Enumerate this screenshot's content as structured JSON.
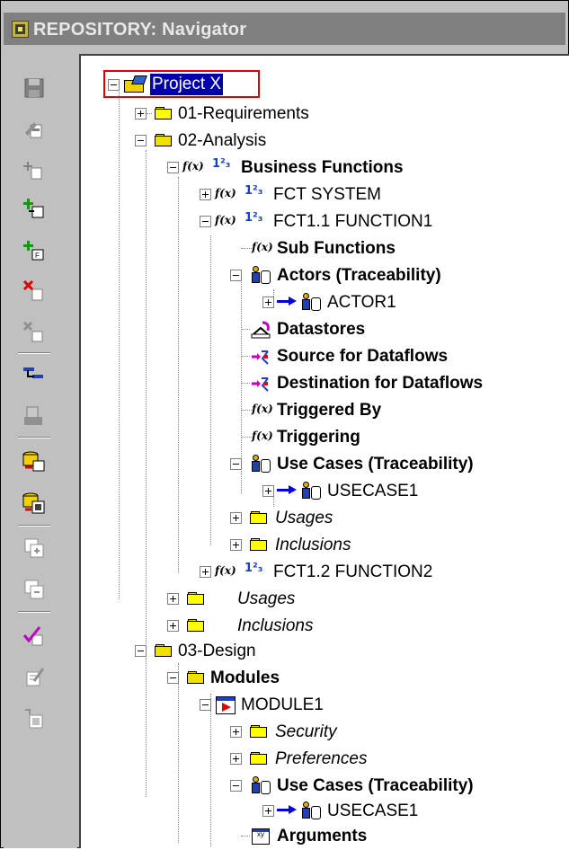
{
  "window": {
    "title": "REPOSITORY: Navigator"
  },
  "toolbar": {
    "buttons": [
      "save-icon",
      "edit-object-icon",
      "create-icon",
      "create-child-icon",
      "create-link-icon",
      "delete-icon",
      "delete-link-icon",
      "hierarchy-icon",
      "print-icon",
      "load-icon",
      "generate-icon",
      "expand-icon",
      "collapse-icon",
      "check-icon",
      "edit-check-icon",
      "disabled-icon"
    ]
  },
  "tree": {
    "nodes": [
      {
        "label": "Project X"
      },
      {
        "label": "01-Requirements"
      },
      {
        "label": "02-Analysis"
      },
      {
        "label": "Business Functions"
      },
      {
        "label": "FCT SYSTEM"
      },
      {
        "label": "FCT1.1 FUNCTION1"
      },
      {
        "label": "Sub Functions"
      },
      {
        "label": "Actors (Traceability)"
      },
      {
        "label": "ACTOR1"
      },
      {
        "label": "Datastores"
      },
      {
        "label": "Source for Dataflows"
      },
      {
        "label": "Destination for Dataflows"
      },
      {
        "label": "Triggered By"
      },
      {
        "label": "Triggering"
      },
      {
        "label": "Use Cases  (Traceability)"
      },
      {
        "label": "USECASE1"
      },
      {
        "label": "Usages"
      },
      {
        "label": "Inclusions"
      },
      {
        "label": "FCT1.2 FUNCTION2"
      },
      {
        "label": "Usages"
      },
      {
        "label": "Inclusions"
      },
      {
        "label": "03-Design"
      },
      {
        "label": "Modules"
      },
      {
        "label": "MODULE1"
      },
      {
        "label": "Security"
      },
      {
        "label": "Preferences"
      },
      {
        "label": "Use Cases  (Traceability)"
      },
      {
        "label": "USECASE1"
      },
      {
        "label": "Arguments"
      }
    ],
    "fx_text": "f(x)",
    "num_text": "1²₃"
  },
  "colors": {
    "selection": "#0000a8",
    "highlight_box": "#e00000",
    "titlebar": "#808080"
  }
}
